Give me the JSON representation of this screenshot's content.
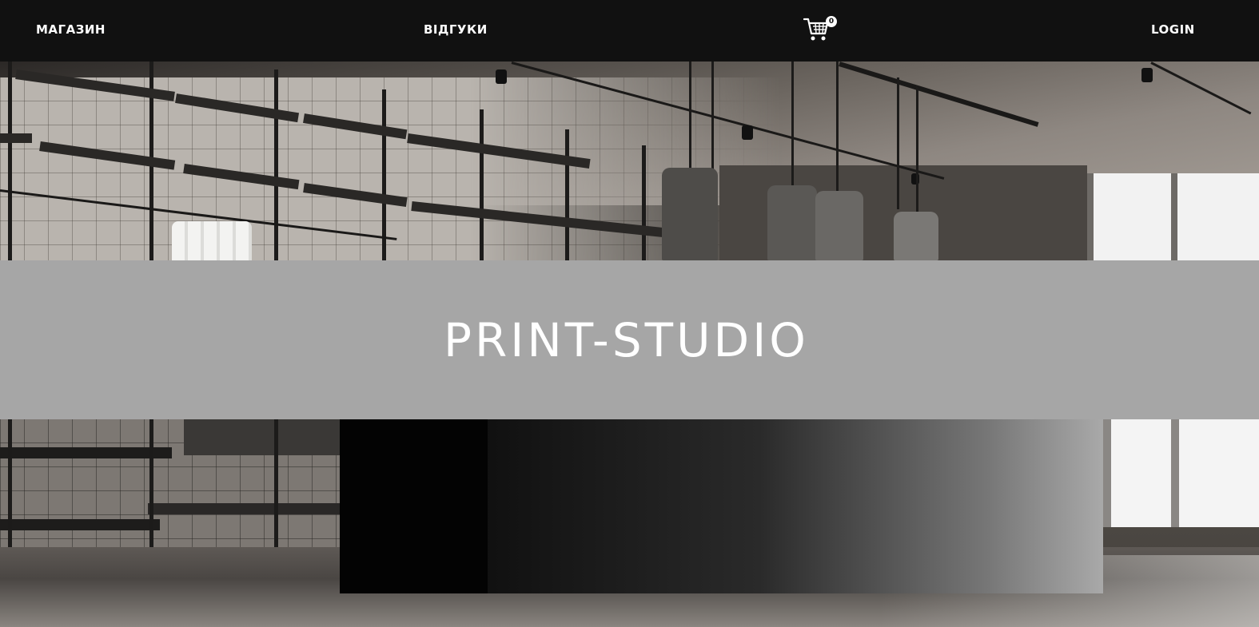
{
  "nav": {
    "shop_label": "МАГАЗИН",
    "reviews_label": "ВІДГУКИ",
    "cart_count": "0",
    "login_label": "LOGIN"
  },
  "hero": {
    "title": "PRINT-STUDIO"
  },
  "colors": {
    "nav_background": "#111111",
    "banner_background": "#a6a6a6",
    "text": "#ffffff"
  },
  "icons": {
    "cart": "shopping-cart-icon"
  }
}
